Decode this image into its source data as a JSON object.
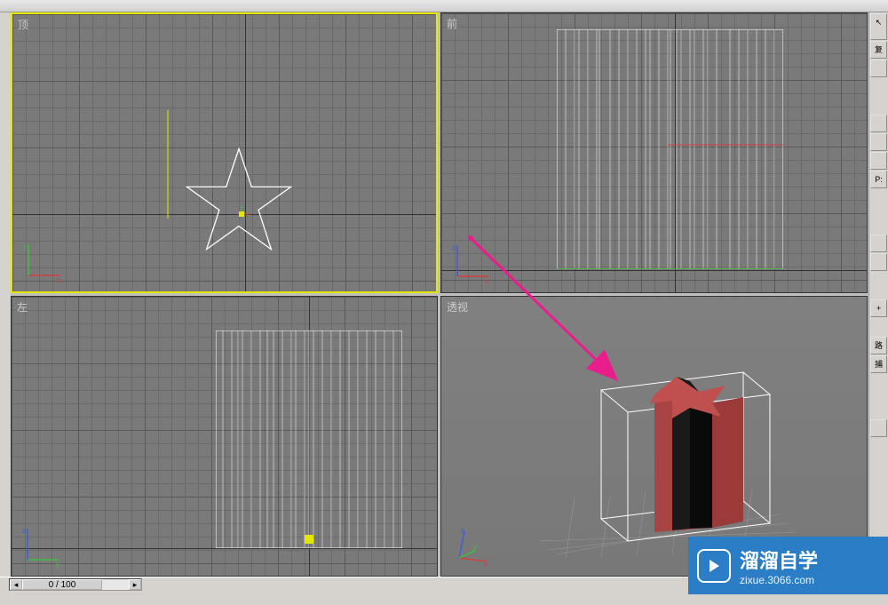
{
  "viewports": {
    "top": {
      "label": "顶",
      "axes": [
        "x",
        "y"
      ]
    },
    "front": {
      "label": "前",
      "axes": [
        "x",
        "z"
      ]
    },
    "left": {
      "label": "左",
      "axes": [
        "y",
        "z"
      ]
    },
    "perspective": {
      "label": "透视",
      "axes": [
        "x",
        "y",
        "z"
      ]
    }
  },
  "timeline": {
    "current_frame": "0 / 100"
  },
  "right_panel": {
    "items": [
      "复",
      "",
      "",
      "",
      "P:",
      "",
      "",
      "",
      "+",
      "",
      "路",
      "捕",
      ""
    ]
  },
  "watermark": {
    "title": "溜溜自学",
    "url": "zixue.3066.com"
  },
  "colors": {
    "accent_yellow": "#e6e600",
    "star_red": "#b04040",
    "arrow_pink": "#e91e8c",
    "watermark_blue": "#2b7ec5"
  }
}
